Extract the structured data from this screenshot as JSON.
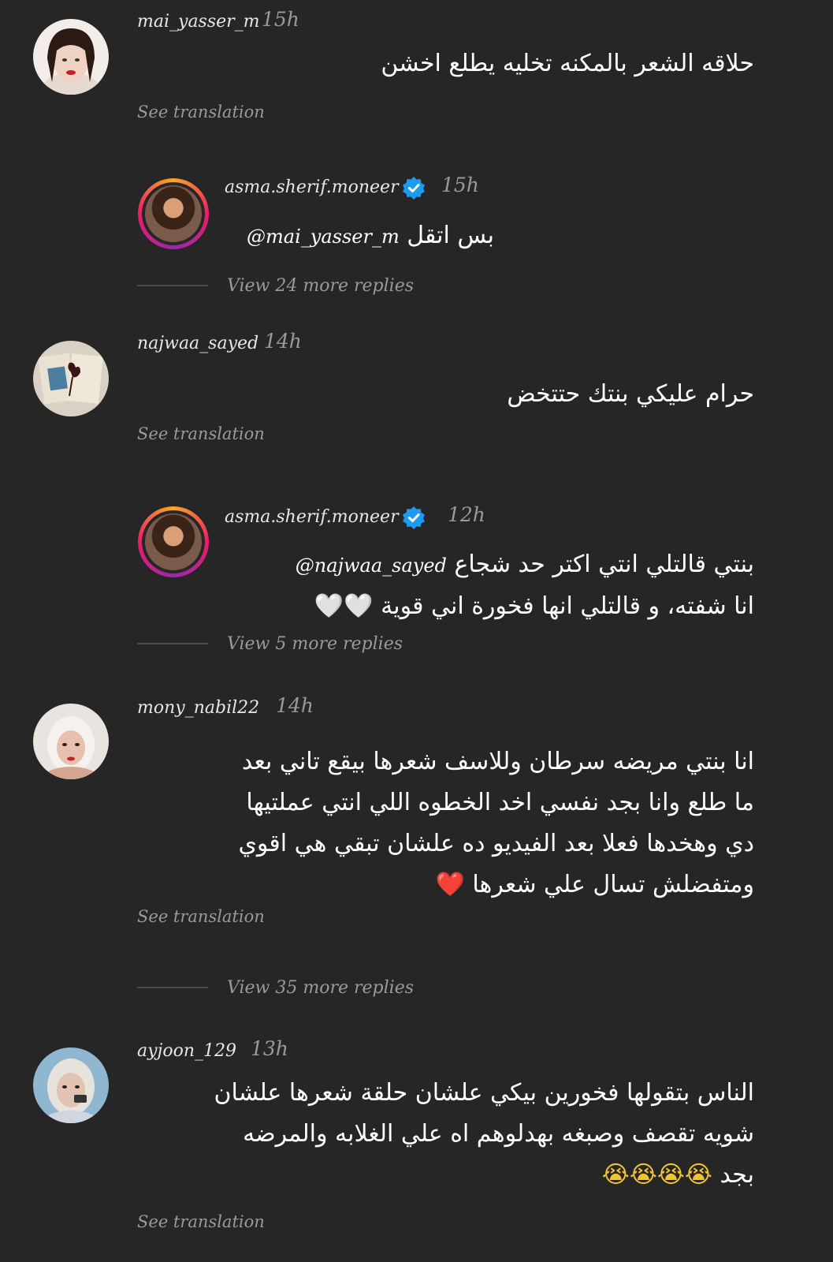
{
  "comments": [
    {
      "username": "mai_yasser_m",
      "time": "15h",
      "text": "حلاقه الشعر بالمكنه تخليه يطلع اخشن",
      "see_translation": "See translation"
    },
    {
      "username": "najwaa_sayed",
      "time": "14h",
      "text": "حرام عليكي بنتك حتتخض",
      "see_translation": "See translation"
    },
    {
      "username": "mony_nabil22",
      "time": "14h",
      "lines": [
        "انا بنتي مريضه سرطان وللاسف شعرها بيقع تاني بعد",
        "ما طلع وانا بجد نفسي اخد الخطوه اللي انتي عملتيها",
        "دي وهخدها فعلا بعد الفيديو ده علشان تبقي هي اقوي",
        "ومتفضلش تسال علي شعرها"
      ],
      "emoji": "❤️",
      "see_translation": "See translation"
    },
    {
      "username": "ayjoon_129",
      "time": "13h",
      "lines": [
        "الناس بتقولها فخورين بيكي علشان  حلقة شعرها علشان",
        "شويه تقصف وصبغه بهدلوهم اه علي الغلابه والمرضه",
        "بجد"
      ],
      "emoji": "😭😭😭😭",
      "see_translation": "See translation"
    }
  ],
  "replies": [
    {
      "username": "asma.sherif.moneer",
      "time": "15h",
      "mention": "@mai_yasser_m",
      "text": "بس اتقل",
      "view_more": "View 24 more replies"
    },
    {
      "username": "asma.sherif.moneer",
      "time": "12h",
      "mention": "@najwaa_sayed",
      "line1": "بنتي قالتلي انتي اكتر حد شجاع",
      "line2": "انا شفته، و قالتلي انها فخورة اني قوية",
      "emoji": "🤍🤍",
      "view_more": "View 5 more replies"
    }
  ],
  "view_more_3": "View 35 more replies",
  "icons": {
    "verified": "verified-badge-icon",
    "verified_color": "#1d9bf0"
  }
}
